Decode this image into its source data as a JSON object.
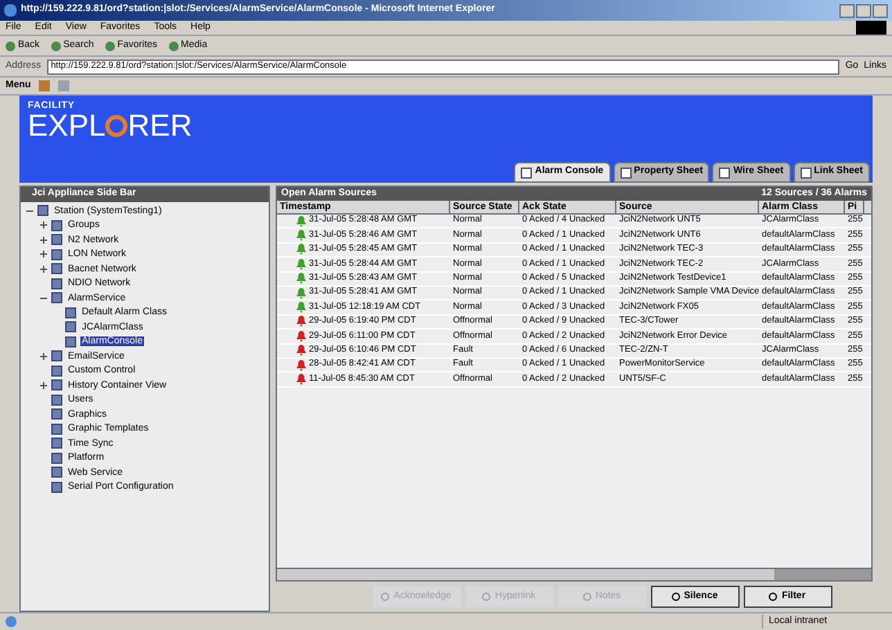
{
  "window": {
    "title": "http://159.222.9.81/ord?station:|slot:/Services/AlarmService/AlarmConsole - Microsoft Internet Explorer"
  },
  "menu_bar": [
    "File",
    "Edit",
    "View",
    "Favorites",
    "Tools",
    "Help"
  ],
  "toolbar": [
    "Back",
    "Search",
    "Favorites",
    "Media"
  ],
  "address": {
    "label": "Address",
    "value": "http://159.222.9.81/ord?station:|slot:/Services/AlarmService/AlarmConsole",
    "go": "Go",
    "links": "Links"
  },
  "app_toolbar": {
    "menu": "Menu"
  },
  "logo": {
    "top": "FACILITY",
    "left": "EXPL",
    "right": "RER"
  },
  "tabs": [
    {
      "label": "Alarm Console",
      "selected": true
    },
    {
      "label": "Property Sheet",
      "selected": false
    },
    {
      "label": "Wire Sheet",
      "selected": false
    },
    {
      "label": "Link Sheet",
      "selected": false
    }
  ],
  "sidebar": {
    "title": "Jci Appliance Side Bar",
    "tree": [
      {
        "label": "Station (SystemTesting1)",
        "expanded": true,
        "selected": false,
        "children": [
          {
            "label": "Groups",
            "expanded": false,
            "selected": false
          },
          {
            "label": "N2 Network",
            "expanded": false,
            "selected": false
          },
          {
            "label": "LON Network",
            "expanded": false,
            "selected": false
          },
          {
            "label": "Bacnet Network",
            "expanded": false,
            "selected": false
          },
          {
            "label": "NDIO Network",
            "selected": false
          },
          {
            "label": "AlarmService",
            "expanded": true,
            "selected": false,
            "children": [
              {
                "label": "Default Alarm Class",
                "selected": false
              },
              {
                "label": "JCAlarmClass",
                "selected": false
              },
              {
                "label": "AlarmConsole",
                "selected": true
              }
            ]
          },
          {
            "label": "EmailService",
            "expanded": false,
            "selected": false
          },
          {
            "label": "Custom Control",
            "selected": false
          },
          {
            "label": "History Container View",
            "expanded": false,
            "selected": false
          },
          {
            "label": "Users",
            "selected": false
          },
          {
            "label": "Graphics",
            "selected": false
          },
          {
            "label": "Graphic Templates",
            "selected": false
          },
          {
            "label": "Time Sync",
            "selected": false
          },
          {
            "label": "Platform",
            "selected": false
          },
          {
            "label": "Web Service",
            "selected": false
          },
          {
            "label": "Serial Port Configuration",
            "selected": false
          }
        ]
      }
    ]
  },
  "alarms": {
    "title": "Open Alarm Sources",
    "summary": "12 Sources / 36 Alarms",
    "columns": [
      "Timestamp",
      "Source State",
      "Ack State",
      "Source",
      "Alarm Class",
      "Pi"
    ],
    "rows": [
      {
        "color": "#3fa02a",
        "cells": [
          "31-Jul-05 5:28:48 AM GMT",
          "Normal",
          "0 Acked / 4 Unacked",
          "JciN2Network UNT5",
          "JCAlarmClass",
          "255"
        ]
      },
      {
        "color": "#3fa02a",
        "cells": [
          "31-Jul-05 5:28:46 AM GMT",
          "Normal",
          "0 Acked / 1 Unacked",
          "JciN2Network UNT6",
          "defaultAlarmClass",
          "255"
        ]
      },
      {
        "color": "#3fa02a",
        "cells": [
          "31-Jul-05 5:28:45 AM GMT",
          "Normal",
          "0 Acked / 1 Unacked",
          "JciN2Network TEC-3",
          "defaultAlarmClass",
          "255"
        ]
      },
      {
        "color": "#3fa02a",
        "cells": [
          "31-Jul-05 5:28:44 AM GMT",
          "Normal",
          "0 Acked / 1 Unacked",
          "JciN2Network TEC-2",
          "JCAlarmClass",
          "255"
        ]
      },
      {
        "color": "#3fa02a",
        "cells": [
          "31-Jul-05 5:28:43 AM GMT",
          "Normal",
          "0 Acked / 5 Unacked",
          "JciN2Network TestDevice1",
          "defaultAlarmClass",
          "255"
        ]
      },
      {
        "color": "#3fa02a",
        "cells": [
          "31-Jul-05 5:28:41 AM GMT",
          "Normal",
          "0 Acked / 1 Unacked",
          "JciN2Network Sample VMA Device",
          "defaultAlarmClass",
          "255"
        ]
      },
      {
        "color": "#3fa02a",
        "cells": [
          "31-Jul-05 12:18:19 AM CDT",
          "Normal",
          "0 Acked / 3 Unacked",
          "JciN2Network FX05",
          "defaultAlarmClass",
          "255"
        ]
      },
      {
        "color": "#d42020",
        "cells": [
          "29-Jul-05 6:19:40 PM CDT",
          "Offnormal",
          "0 Acked / 9 Unacked",
          "TEC-3/CTower",
          "defaultAlarmClass",
          "255"
        ]
      },
      {
        "color": "#d42020",
        "cells": [
          "29-Jul-05 6:11:00 PM CDT",
          "Offnormal",
          "0 Acked / 2 Unacked",
          "JciN2Network Error Device",
          "defaultAlarmClass",
          "255"
        ]
      },
      {
        "color": "#d42020",
        "cells": [
          "29-Jul-05 6:10:46 PM CDT",
          "Fault",
          "0 Acked / 6 Unacked",
          "TEC-2/ZN-T",
          "JCAlarmClass",
          "255"
        ]
      },
      {
        "color": "#d42020",
        "cells": [
          "28-Jul-05 8:42:41 AM CDT",
          "Fault",
          "0 Acked / 1 Unacked",
          "PowerMonitorService",
          "defaultAlarmClass",
          "255"
        ]
      },
      {
        "color": "#d42020",
        "cells": [
          "11-Jul-05 8:45:30 AM CDT",
          "Offnormal",
          "0 Acked / 2 Unacked",
          "UNT5/SF-C",
          "defaultAlarmClass",
          "255"
        ]
      }
    ]
  },
  "buttons": [
    {
      "label": "Acknowledge",
      "disabled": true
    },
    {
      "label": "Hyperlink",
      "disabled": true
    },
    {
      "label": "Notes",
      "disabled": true
    },
    {
      "label": "Silence",
      "disabled": false
    },
    {
      "label": "Filter",
      "disabled": false
    }
  ],
  "status_bar": {
    "zone": "Local intranet"
  }
}
